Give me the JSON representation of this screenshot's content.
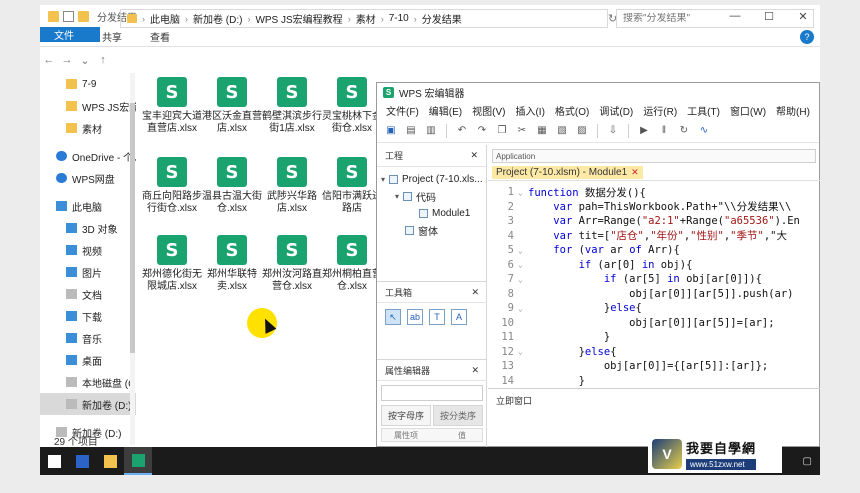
{
  "explorer": {
    "title": "分发结果",
    "window_buttons": [
      "—",
      "☐",
      "✕"
    ],
    "ribbon_tabs": [
      "文件",
      "主页",
      "共享",
      "查看"
    ],
    "address": [
      "此电脑",
      "新加卷 (D:)",
      "WPS JS宏编程教程",
      "素材",
      "7-10",
      "分发结果"
    ],
    "search_placeholder": "搜索\"分发结果\"",
    "sidebar": [
      {
        "label": "7-9",
        "icon": "folder-icon"
      },
      {
        "label": "WPS JS宏编",
        "icon": "folder-icon"
      },
      {
        "label": "素材",
        "icon": "folder-icon"
      },
      {
        "label": "OneDrive - 个人",
        "icon": "cloud-icon"
      },
      {
        "label": "WPS网盘",
        "icon": "cloud-icon"
      },
      {
        "label": "此电脑",
        "icon": "pc-icon"
      },
      {
        "label": "3D 对象",
        "icon": "folder-icon"
      },
      {
        "label": "视频",
        "icon": "folder-icon"
      },
      {
        "label": "图片",
        "icon": "folder-icon"
      },
      {
        "label": "文档",
        "icon": "folder-icon"
      },
      {
        "label": "下载",
        "icon": "folder-icon"
      },
      {
        "label": "音乐",
        "icon": "folder-icon"
      },
      {
        "label": "桌面",
        "icon": "folder-icon"
      },
      {
        "label": "本地磁盘 (C:)",
        "icon": "drive-icon"
      },
      {
        "label": "新加卷 (D:)",
        "icon": "drive-icon"
      },
      {
        "label": "新加卷 (D:)",
        "icon": "drive-icon"
      },
      {
        "label": "网络",
        "icon": "network-icon"
      }
    ],
    "files": [
      {
        "name": "宝丰迎宾大道直营店.xlsx"
      },
      {
        "name": "港区沃金直营店.xlsx"
      },
      {
        "name": "鹤壁淇滨步行街1店.xlsx"
      },
      {
        "name": "灵宝桃林下金街仓.xlsx"
      },
      {
        "name": "商丘向阳路步行街仓.xlsx"
      },
      {
        "name": "温县古温大街仓.xlsx"
      },
      {
        "name": "武陟兴华路店.xlsx"
      },
      {
        "name": "信阳市满跃进路店"
      },
      {
        "name": "郑州德化街无限城店.xlsx"
      },
      {
        "name": "郑州华联特卖.xlsx"
      },
      {
        "name": "郑州汝河路直营仓.xlsx"
      },
      {
        "name": "郑州桐柏直营仓.xlsx"
      }
    ],
    "file_icon_letter": "S",
    "status": "29 个项目"
  },
  "wps": {
    "title": "WPS 宏编辑器",
    "menu": [
      "文件(F)",
      "编辑(E)",
      "视图(V)",
      "插入(I)",
      "格式(O)",
      "调试(D)",
      "运行(R)",
      "工具(T)",
      "窗口(W)",
      "帮助(H)"
    ],
    "project_panel": "工程",
    "tree": {
      "root": "Project (7-10.xls...",
      "code": "代码",
      "module": "Module1",
      "form": "窗体"
    },
    "toolbox_panel": "工具箱",
    "properties_panel": "属性编辑器",
    "prop_tabs": [
      "按字母序",
      "按分类序"
    ],
    "prop_columns": [
      "属性项",
      "值"
    ],
    "app_select": "Application",
    "doc_tab": "Project (7-10.xlsm) - Module1",
    "immediate_panel": "立即窗口",
    "code_lines": [
      {
        "n": "1",
        "fold": "⌄",
        "text": "function 数据分发(){"
      },
      {
        "n": "2",
        "fold": "",
        "text": "    var pah=ThisWorkbook.Path+\"\\\\分发结果\\\\"
      },
      {
        "n": "3",
        "fold": "",
        "text": "    var Arr=Range(\"a2:1\"+Range(\"a65536\").En"
      },
      {
        "n": "4",
        "fold": "",
        "text": "    var tit=[\"店仓\",\"年份\",\"性别\",\"季节\",\"大"
      },
      {
        "n": "5",
        "fold": "⌄",
        "text": "    for (var ar of Arr){"
      },
      {
        "n": "6",
        "fold": "⌄",
        "text": "        if (ar[0] in obj){"
      },
      {
        "n": "7",
        "fold": "⌄",
        "text": "            if (ar[5] in obj[ar[0]]){"
      },
      {
        "n": "8",
        "fold": "",
        "text": "                obj[ar[0]][ar[5]].push(ar)"
      },
      {
        "n": "9",
        "fold": "⌄",
        "text": "            }else{"
      },
      {
        "n": "10",
        "fold": "",
        "text": "                obj[ar[0]][ar[5]]=[ar];"
      },
      {
        "n": "11",
        "fold": "",
        "text": "            }"
      },
      {
        "n": "12",
        "fold": "⌄",
        "text": "        }else{"
      },
      {
        "n": "13",
        "fold": "",
        "text": "            obj[ar[0]]={[ar[5]]:[ar]};"
      },
      {
        "n": "14",
        "fold": "",
        "text": "        }"
      }
    ]
  },
  "watermark": {
    "text": "我要自學網",
    "url": "www.51zxw.net"
  },
  "colors": {
    "ribbon_file": "#1979ca",
    "wps_green": "#1aa36e",
    "taskbar": "#1b1b1b",
    "cursor_highlight": "#ffe100"
  }
}
